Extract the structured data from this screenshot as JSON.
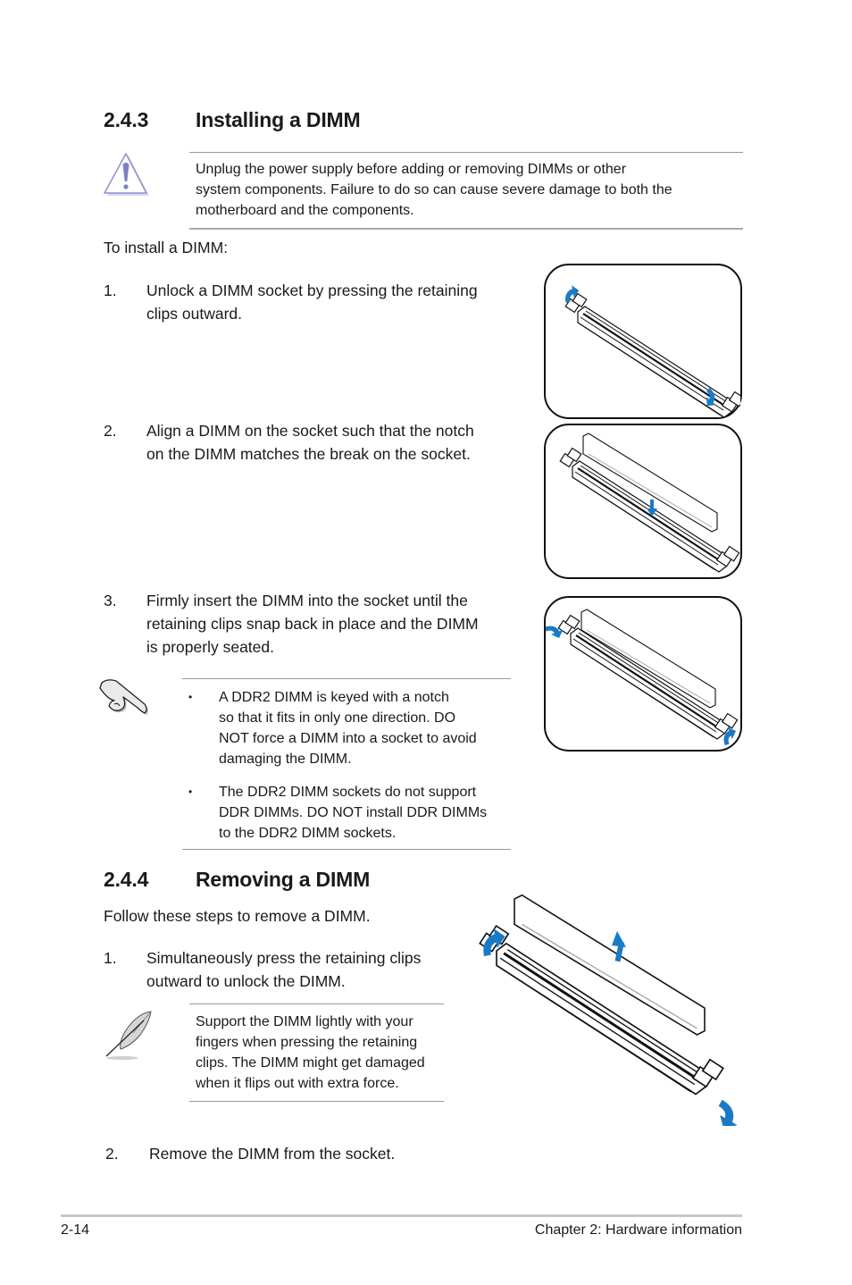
{
  "section_243": {
    "number": "2.4.3",
    "title": "Installing a DIMM",
    "caution": {
      "icon": "warning-triangle-icon",
      "text": "Unplug the power supply before adding or removing DIMMs or other system components. Failure to do so can cause severe damage to both the motherboard and the components.",
      "lines": [
        "Unplug the power supply before adding or removing DIMMs or other",
        "system components. Failure to do so can cause severe damage to both the",
        "motherboard and the components."
      ]
    },
    "intro": "To install a DIMM:",
    "steps": [
      {
        "num": "1.",
        "lines": [
          "Unlock a DIMM socket by pressing the retaining",
          "clips outward."
        ]
      },
      {
        "num": "2.",
        "lines": [
          "Align a DIMM on the socket such that the notch",
          "on the DIMM matches the break on the socket."
        ]
      },
      {
        "num": "3.",
        "lines": [
          "Firmly insert the DIMM into the socket until the",
          "retaining clips snap back in place and the DIMM",
          "is properly seated."
        ]
      }
    ],
    "important_note": {
      "icon": "pointing-hand-icon",
      "bullets": [
        {
          "lines": [
            "A DDR2 DIMM is keyed with a notch",
            "so that it fits in only one direction. DO",
            "NOT force a DIMM into a socket to avoid",
            "damaging the DIMM."
          ]
        },
        {
          "lines": [
            "The DDR2 DIMM sockets do not support",
            "DDR DIMMs. DO NOT install DDR DIMMs",
            "to the DDR2 DIMM sockets."
          ]
        }
      ],
      "bullet_char": "•"
    },
    "figures": [
      "unlock-socket-illustration",
      "align-dimm-illustration",
      "insert-dimm-illustration"
    ]
  },
  "section_244": {
    "number": "2.4.4",
    "title": "Removing a DIMM",
    "intro": "Follow these steps to remove a DIMM.",
    "steps": [
      {
        "num": "1.",
        "lines": [
          "Simultaneously press the retaining clips",
          "outward to unlock the DIMM."
        ]
      },
      {
        "num": "2.",
        "lines": [
          "Remove the DIMM from the socket."
        ]
      }
    ],
    "note": {
      "icon": "feather-quill-icon",
      "lines": [
        "Support the DIMM lightly with your",
        "fingers when pressing the retaining",
        "clips. The DIMM might get damaged",
        "when it flips out with extra force."
      ]
    },
    "figure": "remove-dimm-illustration"
  },
  "footer": {
    "page_number": "2-14",
    "chapter": "Chapter 2: Hardware information"
  },
  "colors": {
    "arrow_blue": "#1a7bc4",
    "warning_purple": "#7b7fc4",
    "rule_gray": "#999999"
  }
}
